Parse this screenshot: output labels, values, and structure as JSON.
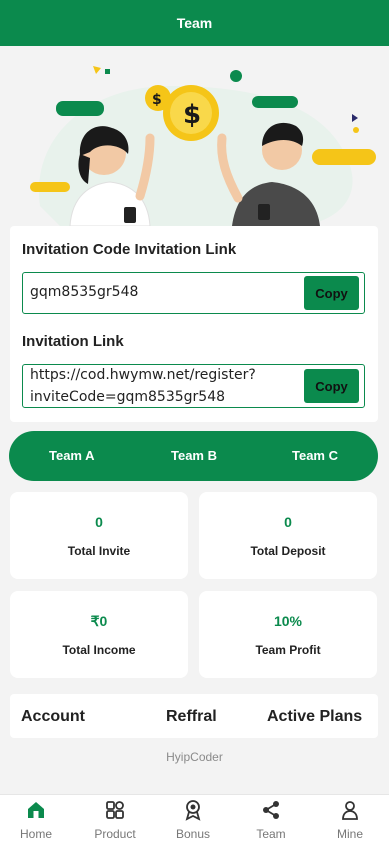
{
  "header": {
    "title": "Team"
  },
  "invite": {
    "code_title": "Invitation Code Invitation Link",
    "code_value": "gqm8535gr548",
    "copy_label": "Copy",
    "link_title": "Invitation Link",
    "link_line1": "https://cod.hwymw.net/register?",
    "link_line2": "inviteCode=gqm8535gr548",
    "link_copy_label": "Copy"
  },
  "teams": {
    "a": "Team A",
    "b": "Team B",
    "c": "Team C"
  },
  "stats": {
    "total_invite": {
      "value": "0",
      "label": "Total Invite"
    },
    "total_deposit": {
      "value": "0",
      "label": "Total Deposit"
    },
    "total_income": {
      "value": "₹0",
      "label": "Total Income"
    },
    "team_profit": {
      "value": "10%",
      "label": "Team Profit"
    }
  },
  "links": {
    "account": "Account",
    "referral": "Reffral",
    "active_plans": "Active Plans"
  },
  "footer": {
    "credit": "HyipCoder"
  },
  "nav": {
    "home": "Home",
    "product": "Product",
    "bonus": "Bonus",
    "team": "Team",
    "mine": "Mine"
  },
  "colors": {
    "primary": "#0b8a4d",
    "background": "#f3f3f3"
  }
}
